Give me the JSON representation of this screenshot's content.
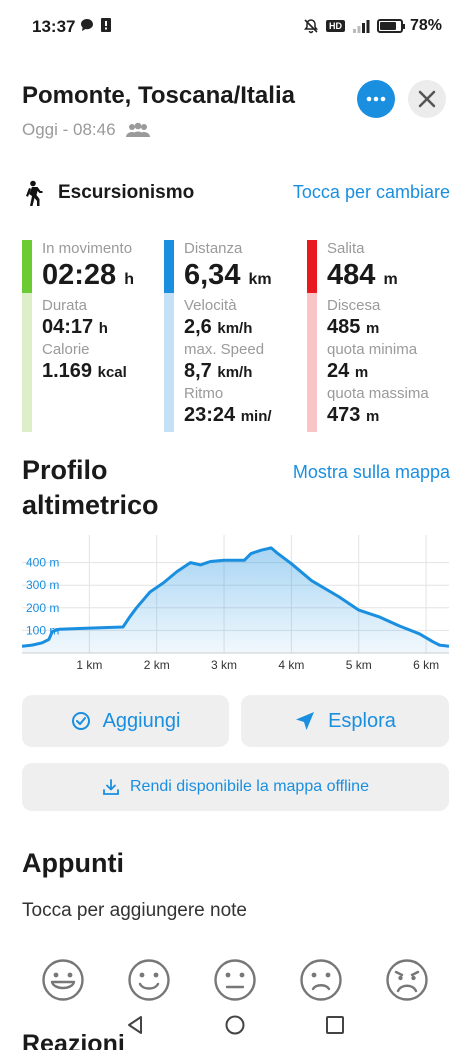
{
  "status_bar": {
    "time": "13:37",
    "network_badge": "HD",
    "battery_percent": "78%",
    "battery_level": 0.78,
    "icons": [
      "chat-bubble-icon",
      "alert-icon",
      "mute-bell-icon",
      "signal-icon",
      "battery-icon"
    ]
  },
  "header": {
    "title": "Pomonte, Toscana/Italia",
    "subtitle": "Oggi - 08:46",
    "more_icon": "more-dots-icon",
    "close_icon": "close-icon"
  },
  "activity": {
    "type": "Escursionismo",
    "change_label": "Tocca per cambiare"
  },
  "stats": {
    "col1": {
      "color_top": "#6ccb32",
      "color_bottom": "#dcefc9",
      "primary_label": "In movimento",
      "primary_value": "02:28",
      "primary_unit": "h",
      "items": [
        {
          "label": "Durata",
          "value": "04:17",
          "unit": "h"
        },
        {
          "label": "Calorie",
          "value": "1.169",
          "unit": "kcal"
        }
      ]
    },
    "col2": {
      "color_top": "#1a8fe0",
      "color_bottom": "#c4e1f6",
      "primary_label": "Distanza",
      "primary_value": "6,34",
      "primary_unit": "km",
      "items": [
        {
          "label": "Velocità",
          "value": "2,6",
          "unit": "km/h"
        },
        {
          "label": "max. Speed",
          "value": "8,7",
          "unit": "km/h"
        },
        {
          "label": "Ritmo",
          "value": "23:24",
          "unit": "min/"
        }
      ]
    },
    "col3": {
      "color_top": "#e8191f",
      "color_bottom": "#f8c4c5",
      "primary_label": "Salita",
      "primary_value": "484",
      "primary_unit": "m",
      "items": [
        {
          "label": "Discesa",
          "value": "485",
          "unit": "m"
        },
        {
          "label": "quota minima",
          "value": "24",
          "unit": "m"
        },
        {
          "label": "quota massima",
          "value": "473",
          "unit": "m"
        }
      ]
    }
  },
  "profile": {
    "title_line1": "Profilo",
    "title_line2": "altimetrico",
    "map_link": "Mostra sulla mappa"
  },
  "chart_data": {
    "type": "area",
    "x_unit": "km",
    "y_unit": "m",
    "xlim": [
      0,
      6.34
    ],
    "ylim": [
      0,
      500
    ],
    "x_ticks": [
      1,
      2,
      3,
      4,
      5,
      6
    ],
    "x_tick_labels": [
      "1 km",
      "2 km",
      "3 km",
      "4 km",
      "5 km",
      "6 km"
    ],
    "y_ticks": [
      100,
      200,
      300,
      400
    ],
    "y_tick_labels": [
      "100 m",
      "200 m",
      "300 m",
      "400 m"
    ],
    "grid": true,
    "series": [
      {
        "color": "#1a8fe0",
        "x": [
          0,
          0.15,
          0.3,
          0.4,
          0.45,
          0.55,
          1.0,
          1.5,
          1.6,
          1.7,
          1.9,
          2.1,
          2.3,
          2.5,
          2.65,
          2.75,
          2.8,
          3.0,
          3.3,
          3.4,
          3.55,
          3.7,
          3.8,
          4.0,
          4.3,
          4.7,
          5.0,
          5.3,
          5.6,
          5.9,
          6.1,
          6.2,
          6.34
        ],
        "y": [
          30,
          35,
          45,
          60,
          95,
          105,
          110,
          115,
          160,
          200,
          270,
          310,
          360,
          400,
          390,
          400,
          405,
          410,
          410,
          440,
          455,
          465,
          440,
          395,
          320,
          250,
          190,
          160,
          120,
          85,
          50,
          35,
          30
        ]
      }
    ]
  },
  "buttons": {
    "add_label": "Aggiungi",
    "explore_label": "Esplora",
    "offline_label": "Rendi disponibile la mappa offline"
  },
  "notes": {
    "title": "Appunti",
    "hint": "Tocca per aggiungere note"
  },
  "reactions": {
    "title": "Reazioni",
    "faces": [
      "very-happy-face-icon",
      "happy-face-icon",
      "neutral-face-icon",
      "sad-face-icon",
      "very-sad-face-icon"
    ]
  },
  "colors": {
    "accent": "#1a8fe0",
    "muted_text": "#9a9a9a",
    "button_bg": "#efefef"
  }
}
